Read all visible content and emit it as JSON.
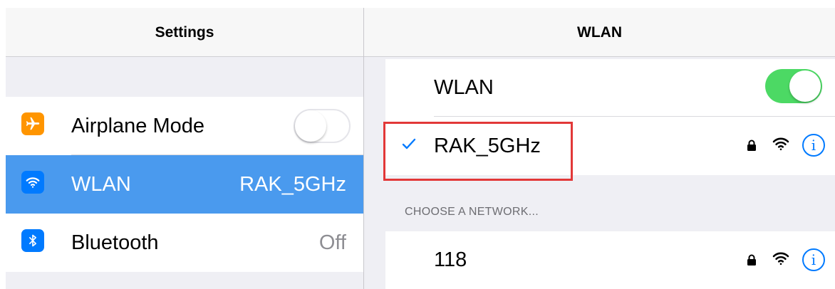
{
  "left": {
    "title": "Settings",
    "items": [
      {
        "label": "Airplane Mode",
        "icon": "airplane-icon",
        "icon_color": "#ff9500",
        "toggle": "off"
      },
      {
        "label": "WLAN",
        "icon": "wifi-icon",
        "icon_color": "#007aff",
        "value": "RAK_5GHz",
        "selected": true
      },
      {
        "label": "Bluetooth",
        "icon": "bluetooth-icon",
        "icon_color": "#007aff",
        "value": "Off"
      }
    ]
  },
  "right": {
    "title": "WLAN",
    "wlan_toggle_label": "WLAN",
    "wlan_toggle": "on",
    "connected_network": "RAK_5GHz",
    "section_header": "CHOOSE A NETWORK...",
    "networks": [
      {
        "name": "118",
        "secured": true
      }
    ]
  },
  "colors": {
    "accent": "#007aff",
    "selection": "#4a9aee",
    "toggle_on": "#4cd964",
    "highlight": "#e23838"
  }
}
